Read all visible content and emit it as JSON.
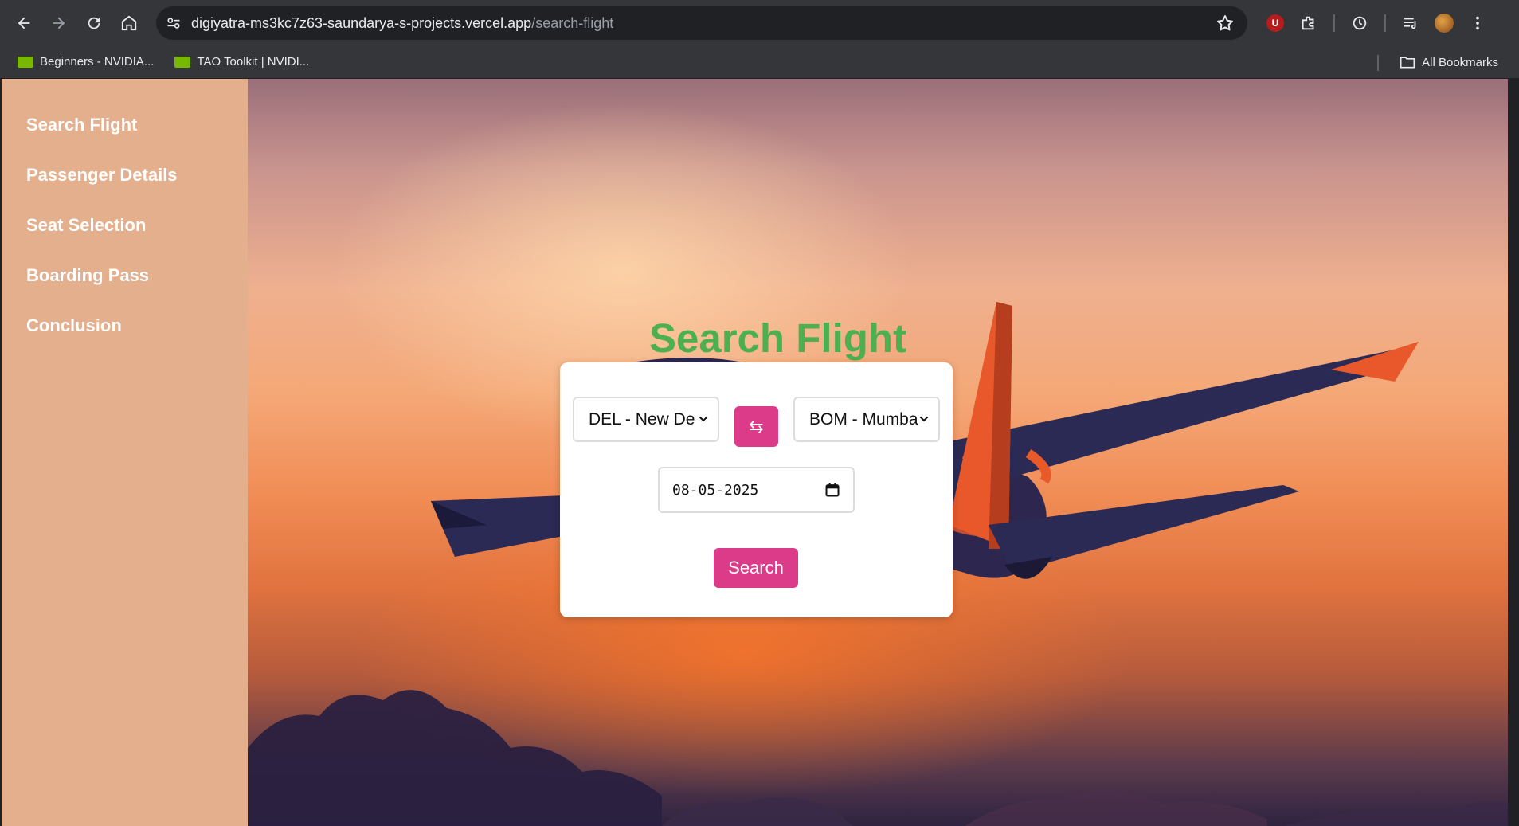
{
  "browser": {
    "url_host": "digiyatra-ms3kc7z63-saundarya-s-projects.vercel.app",
    "url_path": "/search-flight",
    "bookmarks": [
      {
        "label": "Beginners - NVIDIA..."
      },
      {
        "label": "TAO Toolkit | NVIDI..."
      }
    ],
    "all_bookmarks_label": "All Bookmarks",
    "extension_badge": "U"
  },
  "sidebar": {
    "items": [
      {
        "label": "Search Flight"
      },
      {
        "label": "Passenger Details"
      },
      {
        "label": "Seat Selection"
      },
      {
        "label": "Boarding Pass"
      },
      {
        "label": "Conclusion"
      }
    ],
    "background_color": "#e3af8c"
  },
  "main": {
    "title": "Search Flight",
    "title_color": "#4caf50",
    "from_select": {
      "value": "DEL - New De"
    },
    "swap_button": {
      "label": "⇆"
    },
    "to_select": {
      "value": "BOM - Mumba"
    },
    "date_input": {
      "value": "08-05-2025"
    },
    "search_button": {
      "label": "Search"
    },
    "accent_color": "#dc3b89"
  }
}
